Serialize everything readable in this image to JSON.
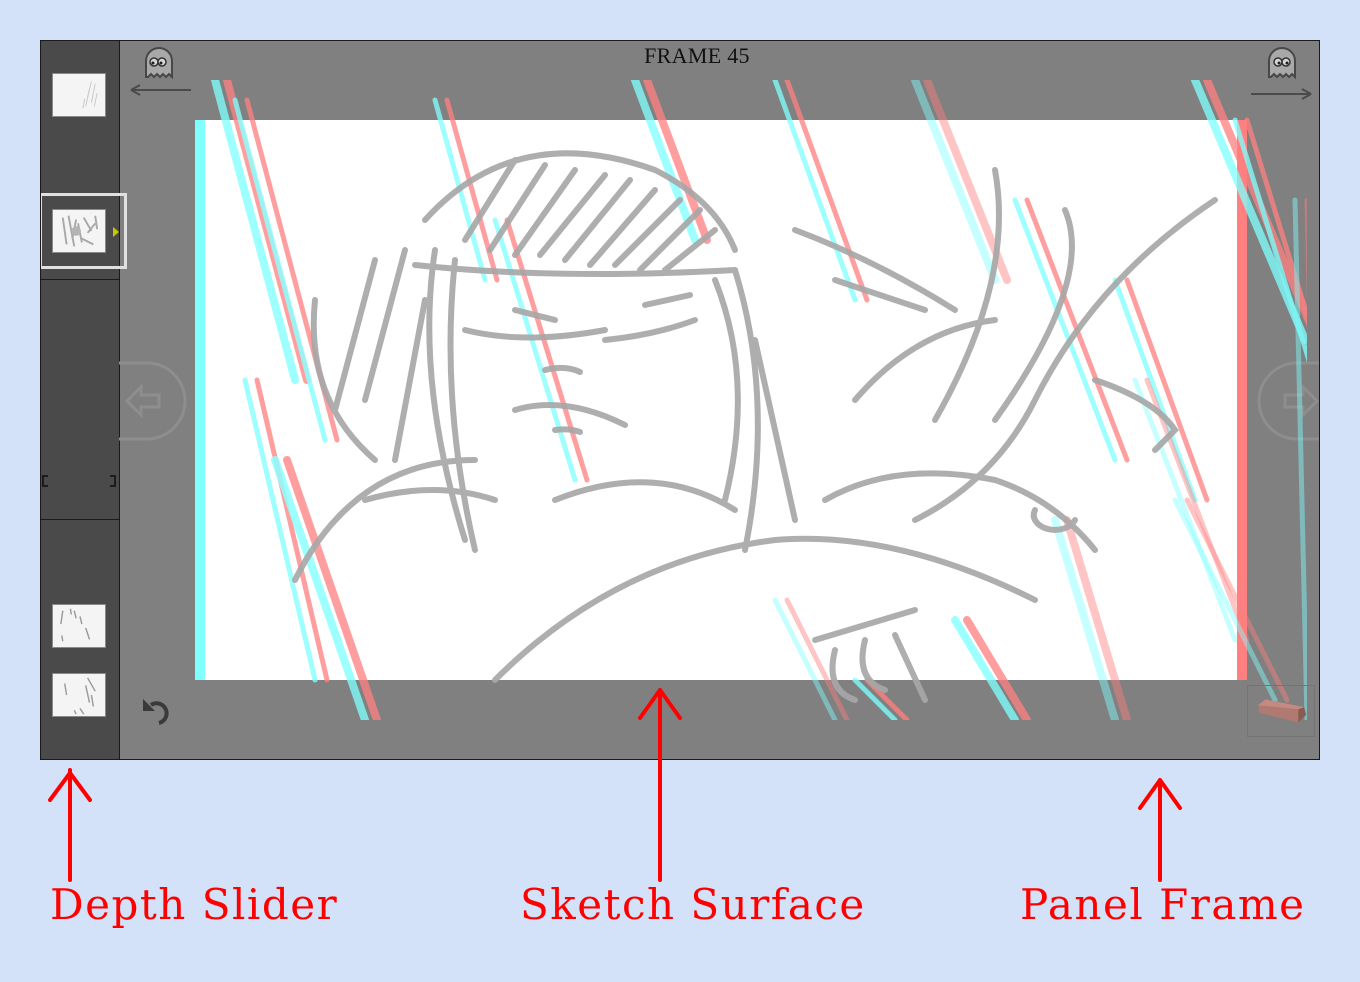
{
  "panel": {
    "frame_title": "FRAME 45",
    "prev_frame_button": "ghost-previous",
    "next_frame_button": "ghost-next",
    "nav_left_icon": "arrow-left-icon",
    "nav_right_icon": "arrow-right-icon",
    "undo_icon": "undo-icon",
    "eraser_icon": "eraser-icon"
  },
  "depth_slider": {
    "thumbnails": [
      {
        "label": "layer-1",
        "selected": false
      },
      {
        "label": "layer-2",
        "selected": true
      },
      {
        "label": "layer-3",
        "selected": false
      },
      {
        "label": "layer-4",
        "selected": false
      }
    ]
  },
  "colors": {
    "background": "#d3e1f9",
    "panel": "#808080",
    "depth_bg": "#4a4a4a",
    "stereo_cyan": "#80ffff",
    "stereo_red": "#ff8080",
    "sketch_gray": "#b0b0b0",
    "annotation": "#ff0000",
    "selection_marker": "#c8c800"
  },
  "annotations": [
    {
      "label": "Depth Slider"
    },
    {
      "label": "Sketch Surface"
    },
    {
      "label": "Panel Frame"
    }
  ]
}
